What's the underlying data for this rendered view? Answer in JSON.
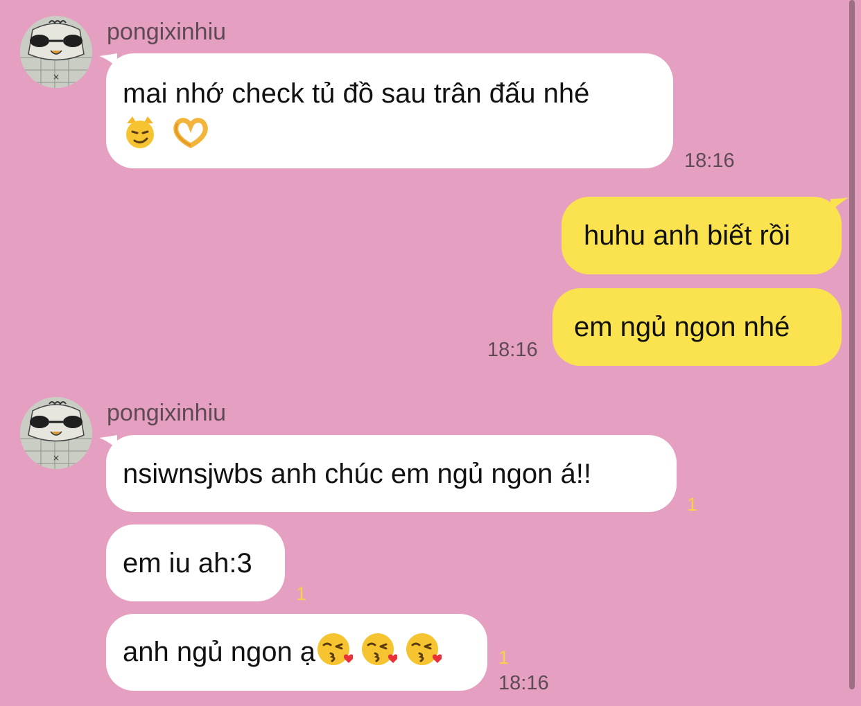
{
  "sender": {
    "name": "pongixinhiu"
  },
  "messages": {
    "m1": {
      "line1": "mai nhớ check tủ đồ sau trân đấu nhé",
      "line2_emoji": [
        "smirking-cat-emoji",
        "heart-hands-emoji"
      ],
      "time": "18:16"
    },
    "m2": {
      "text": "huhu anh biết rồi"
    },
    "m3": {
      "text": "em ngủ ngon nhé",
      "time": "18:16"
    },
    "m4": {
      "text": "nsiwnsjwbs anh chúc em ngủ ngon á!!",
      "read_count": "1"
    },
    "m5": {
      "text": "em iu ah:3",
      "read_count": "1"
    },
    "m6": {
      "text": "anh ngủ ngon ạ",
      "emoji": [
        "kiss-heart-emoji",
        "kiss-heart-emoji",
        "kiss-heart-emoji"
      ],
      "read_count": "1",
      "time": "18:16"
    }
  },
  "colors": {
    "background": "#e59fc0",
    "incoming_bubble": "#ffffff",
    "outgoing_bubble": "#fae34e",
    "read_indicator": "#f5d24b",
    "meta_text": "#5e4a55"
  }
}
